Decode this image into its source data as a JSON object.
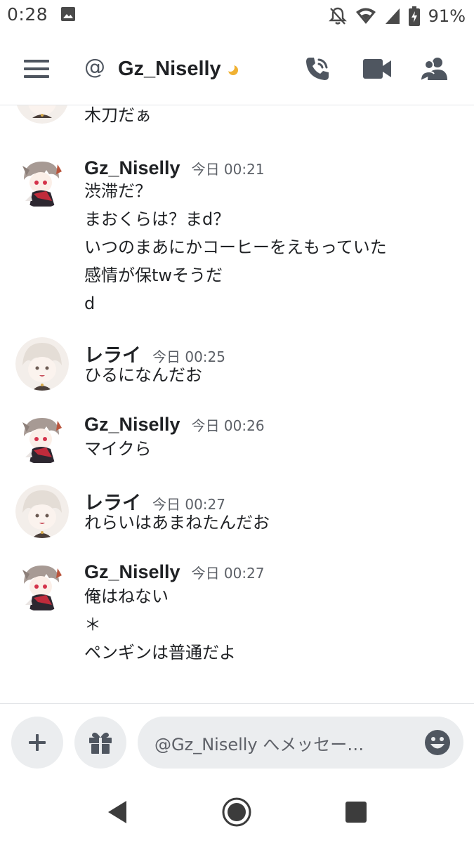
{
  "status_bar": {
    "time": "0:28",
    "battery_percent": "91%",
    "icons": [
      "image-icon",
      "notifications-off-icon",
      "wifi-icon",
      "signal-icon",
      "battery-icon"
    ]
  },
  "header": {
    "channel_prefix": "@",
    "channel_name": "Gz_Niselly",
    "status": "idle-moon-icon",
    "icons": [
      "menu-icon",
      "voice-call-icon",
      "video-call-icon",
      "members-icon"
    ]
  },
  "messages": [
    {
      "author": "",
      "time": "",
      "lines": [
        "木刀だぁ"
      ],
      "avatar": "rerai-avatar"
    },
    {
      "author": "Gz_Niselly",
      "time": "今日 00:21",
      "lines": [
        "渋滞だ？",
        "まおくらは？まd？",
        "いつのまあにかコーヒーをえもっていた",
        "感情が保twそうだ",
        "d"
      ],
      "avatar": "niselly-avatar"
    },
    {
      "author": "レライ",
      "time": "今日 00:25",
      "lines": [
        "ひるになんだお"
      ],
      "avatar": "rerai-avatar"
    },
    {
      "author": "Gz_Niselly",
      "time": "今日 00:26",
      "lines": [
        "マイクら"
      ],
      "avatar": "niselly-avatar"
    },
    {
      "author": "レライ",
      "time": "今日 00:27",
      "lines": [
        "れらいはあまねたんだお"
      ],
      "avatar": "rerai-avatar"
    },
    {
      "author": "Gz_Niselly",
      "time": "今日 00:27",
      "lines": [
        "俺はねない",
        "＊",
        "ペンギンは普通だよ"
      ],
      "avatar": "niselly-avatar"
    }
  ],
  "composer": {
    "placeholder": "@Gz_Niselly へメッセー…"
  },
  "colors": {
    "background": "#ffffff",
    "text": "#1f2124",
    "muted": "#5c6067",
    "input_bg": "#ebedef",
    "idle": "#f0b132"
  }
}
